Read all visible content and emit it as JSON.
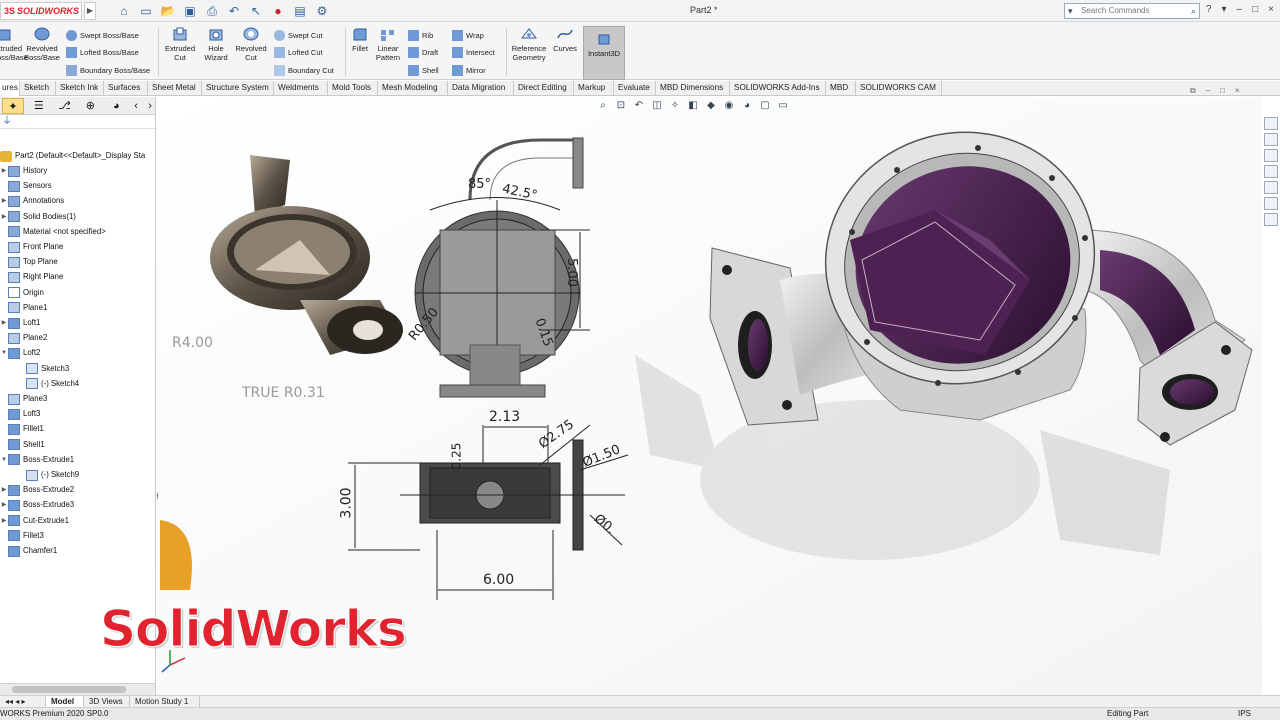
{
  "titlebar": {
    "app_logo_ds": "3S",
    "app_logo": "SOLIDWORKS",
    "document_title": "Part2 *",
    "search_placeholder": "Search Commands"
  },
  "commands": {
    "extruded_boss": "Extruded\nBoss/Base",
    "revolved_boss": "Revolved\nBoss/Base",
    "swept_boss": "Swept Boss/Base",
    "lofted_boss": "Lofted Boss/Base",
    "boundary_boss": "Boundary Boss/Base",
    "extruded_cut": "Extruded\nCut",
    "hole_wizard": "Hole\nWizard",
    "revolved_cut": "Revolved\nCut",
    "swept_cut": "Swept Cut",
    "lofted_cut": "Lofted Cut",
    "boundary_cut": "Boundary Cut",
    "fillet": "Fillet",
    "linear_pattern": "Linear\nPattern",
    "rib": "Rib",
    "draft": "Draft",
    "shell": "Shell",
    "wrap": "Wrap",
    "intersect": "Intersect",
    "mirror": "Mirror",
    "reference_geometry": "Reference\nGeometry",
    "curves": "Curves",
    "instant3d": "Instant3D"
  },
  "tabs": [
    "ures",
    "Sketch",
    "Sketch Ink",
    "Surfaces",
    "Sheet Metal",
    "Structure System",
    "Weldments",
    "Mold Tools",
    "Mesh Modeling",
    "Data Migration",
    "Direct Editing",
    "Markup",
    "Evaluate",
    "MBD Dimensions",
    "SOLIDWORKS Add-Ins",
    "MBD",
    "SOLIDWORKS CAM"
  ],
  "tree": {
    "root": "Part2  (Default<<Default>_Display Sta",
    "items": [
      "History",
      "Sensors",
      "Annotations",
      "Solid Bodies(1)",
      "Material <not specified>",
      "Front Plane",
      "Top Plane",
      "Right Plane",
      "Origin",
      "Plane1",
      "Loft1",
      "Plane2",
      "Loft2",
      "Sketch3",
      "(-) Sketch4",
      "Plane3",
      "Loft3",
      "Fillet1",
      "Shell1",
      "Boss-Extrude1",
      "(-) Sketch9",
      "Boss-Extrude2",
      "Boss-Extrude3",
      "Cut-Extrude1",
      "Fillet3",
      "Chamfer1"
    ]
  },
  "drawing": {
    "r400": "R4.00",
    "true_r031": "TRUE R0.31",
    "angle85": "85°",
    "angle425": "42.5°",
    "dim500": "5.00",
    "r050": "R0.50",
    "dim015": "0.15",
    "dim213": "2.13",
    "dia275": "Ø2.75",
    "dia150": "Ø1.50",
    "dia0": "Ø0.",
    "dim025": "0.25",
    "dim300": "3.00",
    "dim600": "6.00"
  },
  "watermark": "SolidWorks",
  "bottom_tabs": [
    "Model",
    "3D Views",
    "Motion Study 1"
  ],
  "status": {
    "left": "WORKS Premium 2020 SP0.0",
    "editing": "Editing Part",
    "units": "IPS"
  },
  "colors": {
    "brand_red": "#d8232a",
    "ds_blue": "#1f3e9e",
    "ds_orange": "#e7a126",
    "part_purple": "#4a1d4f",
    "part_silver": "#dcdcdc"
  }
}
